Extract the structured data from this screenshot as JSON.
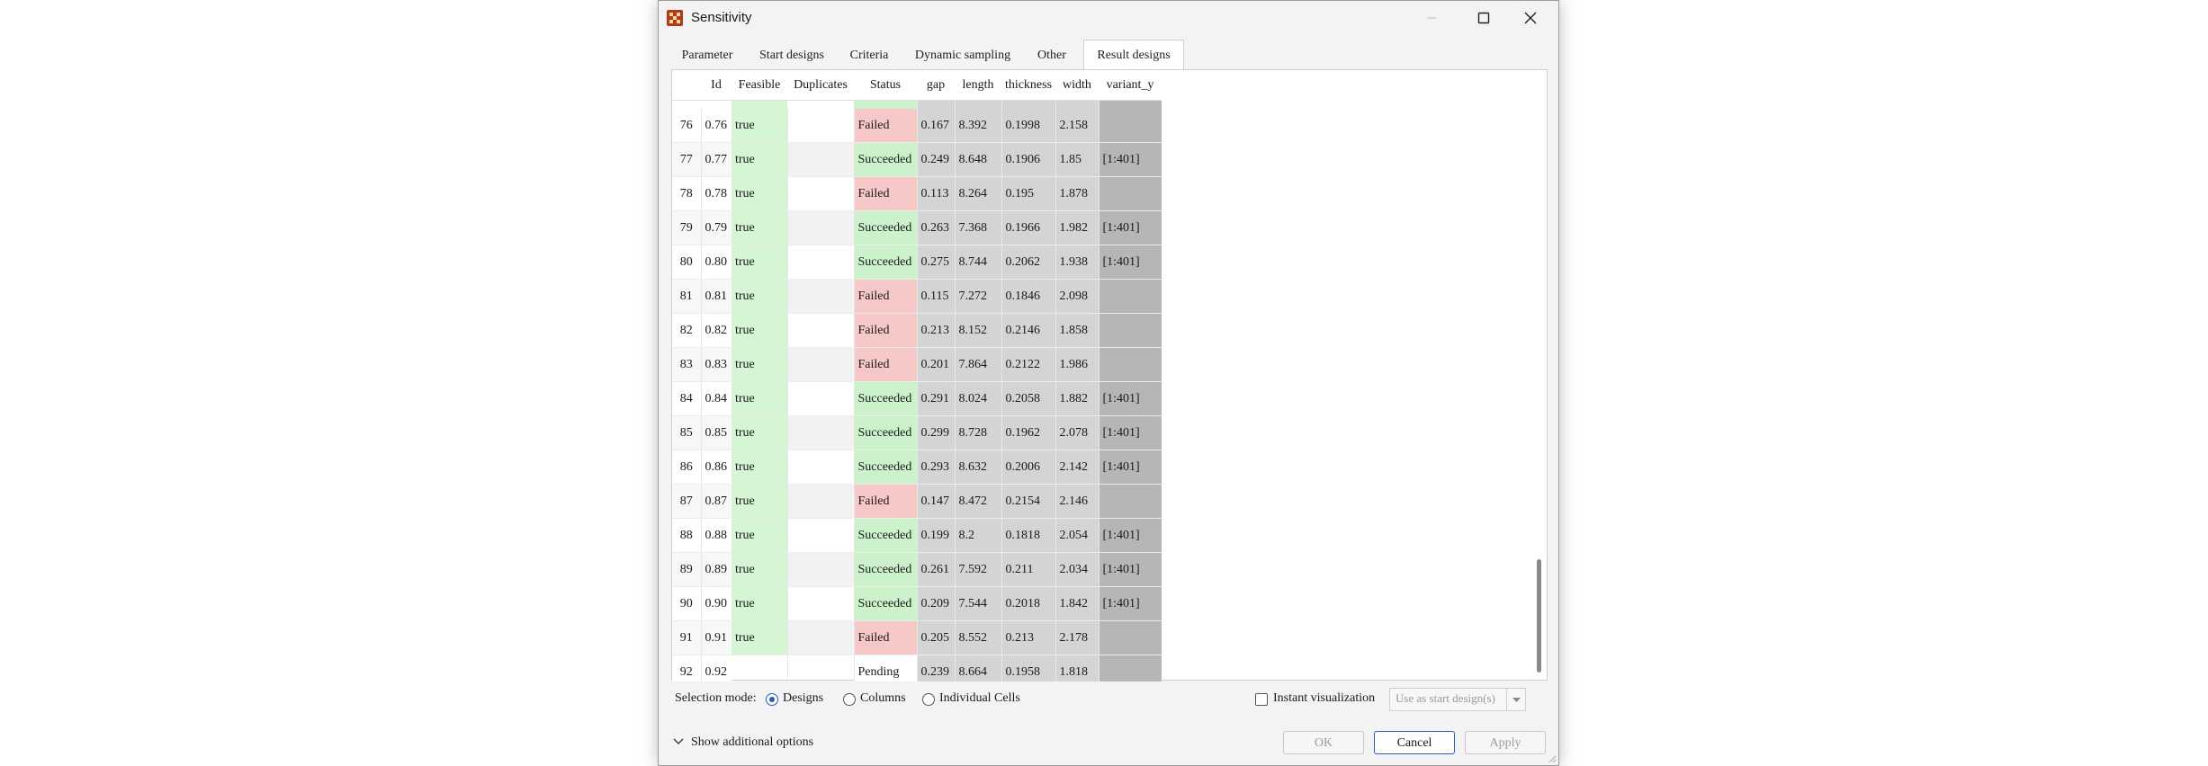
{
  "window": {
    "title": "Sensitivity"
  },
  "tabs": [
    "Parameter",
    "Start designs",
    "Criteria",
    "Dynamic sampling",
    "Other",
    "Result designs"
  ],
  "active_tab": "Result designs",
  "table": {
    "columns": [
      "Id",
      "Feasible",
      "Duplicates",
      "Status",
      "gap",
      "length",
      "thickness",
      "width",
      "variant_y"
    ],
    "rows": [
      {
        "n": "76",
        "id": "0.76",
        "feasible": "true",
        "dup": "",
        "status": "Failed",
        "gap": "0.167",
        "length": "8.392",
        "thickness": "0.1998",
        "width": "2.158",
        "variant": ""
      },
      {
        "n": "77",
        "id": "0.77",
        "feasible": "true",
        "dup": "",
        "status": "Succeeded",
        "gap": "0.249",
        "length": "8.648",
        "thickness": "0.1906",
        "width": "1.85",
        "variant": "[1:401]"
      },
      {
        "n": "78",
        "id": "0.78",
        "feasible": "true",
        "dup": "",
        "status": "Failed",
        "gap": "0.113",
        "length": "8.264",
        "thickness": "0.195",
        "width": "1.878",
        "variant": ""
      },
      {
        "n": "79",
        "id": "0.79",
        "feasible": "true",
        "dup": "",
        "status": "Succeeded",
        "gap": "0.263",
        "length": "7.368",
        "thickness": "0.1966",
        "width": "1.982",
        "variant": "[1:401]"
      },
      {
        "n": "80",
        "id": "0.80",
        "feasible": "true",
        "dup": "",
        "status": "Succeeded",
        "gap": "0.275",
        "length": "8.744",
        "thickness": "0.2062",
        "width": "1.938",
        "variant": "[1:401]"
      },
      {
        "n": "81",
        "id": "0.81",
        "feasible": "true",
        "dup": "",
        "status": "Failed",
        "gap": "0.115",
        "length": "7.272",
        "thickness": "0.1846",
        "width": "2.098",
        "variant": ""
      },
      {
        "n": "82",
        "id": "0.82",
        "feasible": "true",
        "dup": "",
        "status": "Failed",
        "gap": "0.213",
        "length": "8.152",
        "thickness": "0.2146",
        "width": "1.858",
        "variant": ""
      },
      {
        "n": "83",
        "id": "0.83",
        "feasible": "true",
        "dup": "",
        "status": "Failed",
        "gap": "0.201",
        "length": "7.864",
        "thickness": "0.2122",
        "width": "1.986",
        "variant": ""
      },
      {
        "n": "84",
        "id": "0.84",
        "feasible": "true",
        "dup": "",
        "status": "Succeeded",
        "gap": "0.291",
        "length": "8.024",
        "thickness": "0.2058",
        "width": "1.882",
        "variant": "[1:401]"
      },
      {
        "n": "85",
        "id": "0.85",
        "feasible": "true",
        "dup": "",
        "status": "Succeeded",
        "gap": "0.299",
        "length": "8.728",
        "thickness": "0.1962",
        "width": "2.078",
        "variant": "[1:401]"
      },
      {
        "n": "86",
        "id": "0.86",
        "feasible": "true",
        "dup": "",
        "status": "Succeeded",
        "gap": "0.293",
        "length": "8.632",
        "thickness": "0.2006",
        "width": "2.142",
        "variant": "[1:401]"
      },
      {
        "n": "87",
        "id": "0.87",
        "feasible": "true",
        "dup": "",
        "status": "Failed",
        "gap": "0.147",
        "length": "8.472",
        "thickness": "0.2154",
        "width": "2.146",
        "variant": ""
      },
      {
        "n": "88",
        "id": "0.88",
        "feasible": "true",
        "dup": "",
        "status": "Succeeded",
        "gap": "0.199",
        "length": "8.2",
        "thickness": "0.1818",
        "width": "2.054",
        "variant": "[1:401]"
      },
      {
        "n": "89",
        "id": "0.89",
        "feasible": "true",
        "dup": "",
        "status": "Succeeded",
        "gap": "0.261",
        "length": "7.592",
        "thickness": "0.211",
        "width": "2.034",
        "variant": "[1:401]"
      },
      {
        "n": "90",
        "id": "0.90",
        "feasible": "true",
        "dup": "",
        "status": "Succeeded",
        "gap": "0.209",
        "length": "7.544",
        "thickness": "0.2018",
        "width": "1.842",
        "variant": "[1:401]"
      },
      {
        "n": "91",
        "id": "0.91",
        "feasible": "true",
        "dup": "",
        "status": "Failed",
        "gap": "0.205",
        "length": "8.552",
        "thickness": "0.213",
        "width": "2.178",
        "variant": ""
      },
      {
        "n": "92",
        "id": "0.92",
        "feasible": "",
        "dup": "",
        "status": "Pending",
        "gap": "0.239",
        "length": "8.664",
        "thickness": "0.1958",
        "width": "1.818",
        "variant": ""
      }
    ]
  },
  "selection": {
    "label": "Selection mode:",
    "options": [
      "Designs",
      "Columns",
      "Individual Cells"
    ],
    "selected": "Designs"
  },
  "instant_visualization": {
    "label": "Instant visualization",
    "checked": false
  },
  "use_as_start": "Use as start design(s)",
  "show_more": "Show additional options",
  "buttons": {
    "ok": "OK",
    "cancel": "Cancel",
    "apply": "Apply"
  },
  "colors": {
    "accent": "#1f5fbf",
    "succeeded": "#ccf2cc",
    "failed": "#f7c8c8",
    "feasible": "#d5f5d5",
    "variant_col": "#b6b6b6",
    "param_col": "#d4d4d4"
  }
}
